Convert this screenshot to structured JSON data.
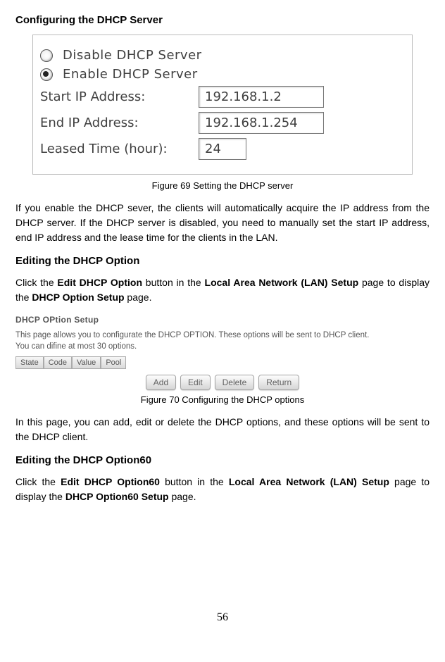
{
  "section1": {
    "title": "Configuring the DHCP Server"
  },
  "fig69": {
    "disable_label": "Disable DHCP Server",
    "enable_label": "Enable DHCP Server",
    "start_label": "Start IP Address:",
    "start_value": "192.168.1.2",
    "end_label": "End IP Address:",
    "end_value": "192.168.1.254",
    "lease_label": "Leased Time (hour):",
    "lease_value": "24",
    "caption": "Figure 69 Setting the DHCP server"
  },
  "para1": {
    "text": "If you enable the DHCP sever, the clients will automatically acquire the IP address from the DHCP server. If the DHCP server is disabled, you need to manually set the start IP address, end IP address and the lease time for the clients in the LAN."
  },
  "section2": {
    "title": "Editing the DHCP Option",
    "pre": "Click the ",
    "b1": "Edit DHCP Option",
    "mid1": " button in the ",
    "b2": "Local Area Network (LAN) Setup",
    "mid2": " page to display the ",
    "b3": "DHCP Option Setup",
    "post": " page."
  },
  "fig70": {
    "title": "DHCP OPtion Setup",
    "desc1": "This page allows you to configurate the DHCP OPTION. These options will be sent to DHCP client.",
    "desc2": "You can difine at most 30 options.",
    "th1": "State",
    "th2": "Code",
    "th3": "Value",
    "th4": "Pool",
    "btn_add": "Add",
    "btn_edit": "Edit",
    "btn_delete": "Delete",
    "btn_return": "Return",
    "caption": "Figure 70 Configuring the DHCP options"
  },
  "para2": {
    "text": "In this page, you can add, edit or delete the DHCP options, and these options will be sent to the DHCP client."
  },
  "section3": {
    "title": "Editing the DHCP Option60",
    "pre": "Click the ",
    "b1": "Edit DHCP Option60",
    "mid1": " button in the ",
    "b2": "Local Area Network (LAN) Setup",
    "mid2": " page to display the ",
    "b3": "DHCP Option60 Setup",
    "post": " page."
  },
  "page_number": "56"
}
